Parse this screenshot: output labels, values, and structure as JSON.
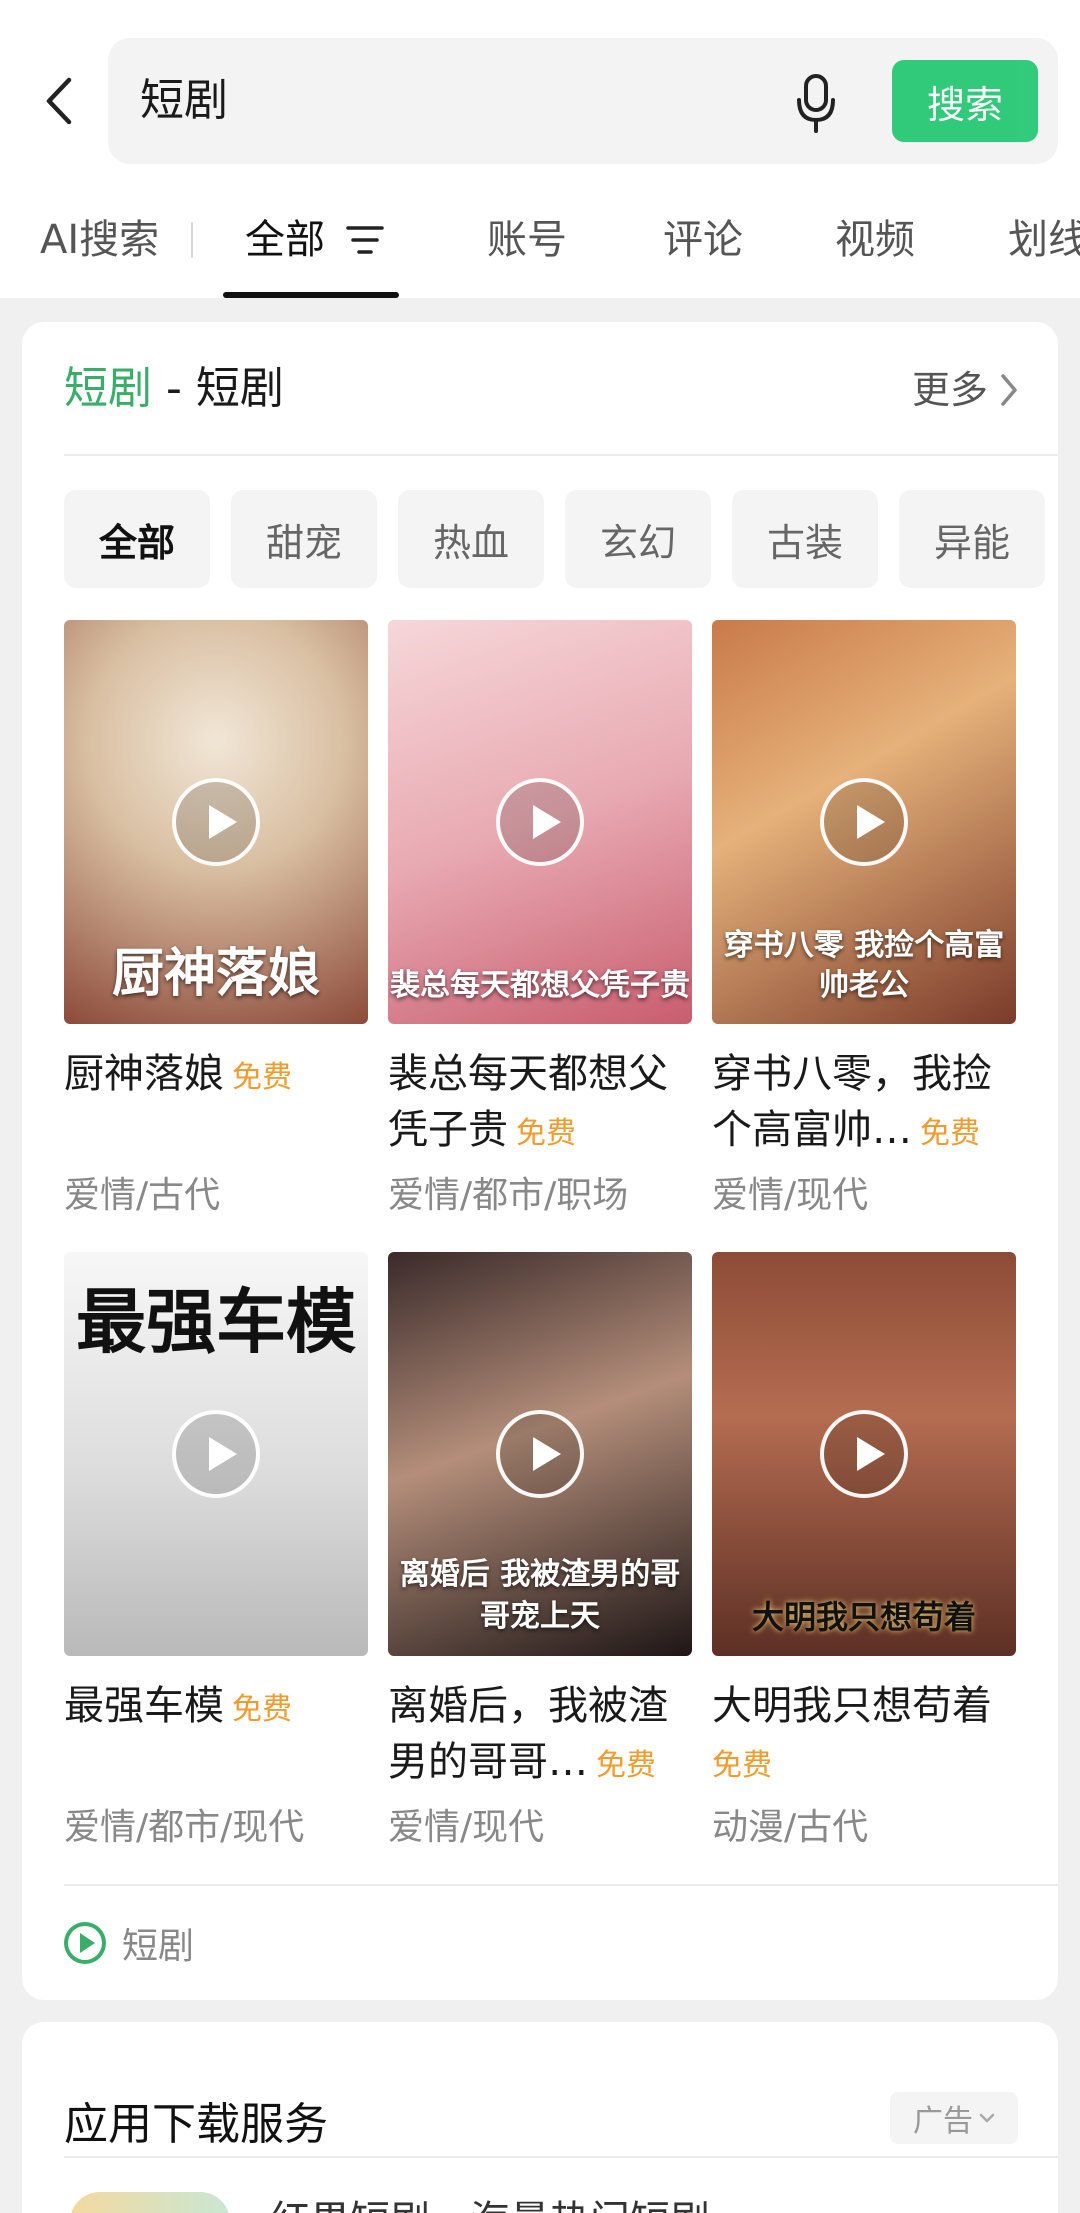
{
  "search": {
    "query": "短剧",
    "button_label": "搜索"
  },
  "tabs": [
    {
      "label": "AI搜索"
    },
    {
      "label": "全部"
    },
    {
      "label": "账号"
    },
    {
      "label": "评论"
    },
    {
      "label": "视频"
    },
    {
      "label": "划线"
    }
  ],
  "drama_card": {
    "title_prefix": "短剧",
    "title_sep": " - ",
    "title_suffix": "短剧",
    "more_label": "更多",
    "chips": [
      "全部",
      "甜宠",
      "热血",
      "玄幻",
      "古装",
      "异能"
    ],
    "items": [
      {
        "title": "厨神落娘",
        "badge": "免费",
        "tags": "爱情/古代",
        "poster_text": "厨神落娘"
      },
      {
        "title": "裴总每天都想父凭子贵",
        "badge": "免费",
        "tags": "爱情/都市/职场",
        "poster_text": "裴总每天都想父凭子贵"
      },
      {
        "title": "穿书八零，我捡个高富帅…",
        "badge": "免费",
        "tags": "爱情/现代",
        "poster_text": "穿书八零 我捡个高富帅老公"
      },
      {
        "title": "最强车模",
        "badge": "免费",
        "tags": "爱情/都市/现代",
        "poster_text": "最强车模"
      },
      {
        "title": "离婚后，我被渣男的哥哥…",
        "badge": "免费",
        "tags": "爱情/现代",
        "poster_text": "离婚后 我被渣男的哥哥宠上天"
      },
      {
        "title": "大明我只想苟着",
        "badge": "免费",
        "tags": "动漫/古代",
        "poster_text": "大明我只想苟着"
      }
    ],
    "source_label": "短剧"
  },
  "app_card": {
    "title": "应用下载服务",
    "ad_label": "广告",
    "app_title": "红果短剧 - 海量热门短剧"
  },
  "colors": {
    "accent_green": "#07c160",
    "label_green": "#39ae68",
    "badge_orange": "#f29b2b"
  },
  "icons": [
    "back-arrow-icon",
    "microphone-icon",
    "filter-icon",
    "chevron-right-icon",
    "play-icon",
    "short-drama-logo-icon",
    "chevron-down-icon"
  ]
}
